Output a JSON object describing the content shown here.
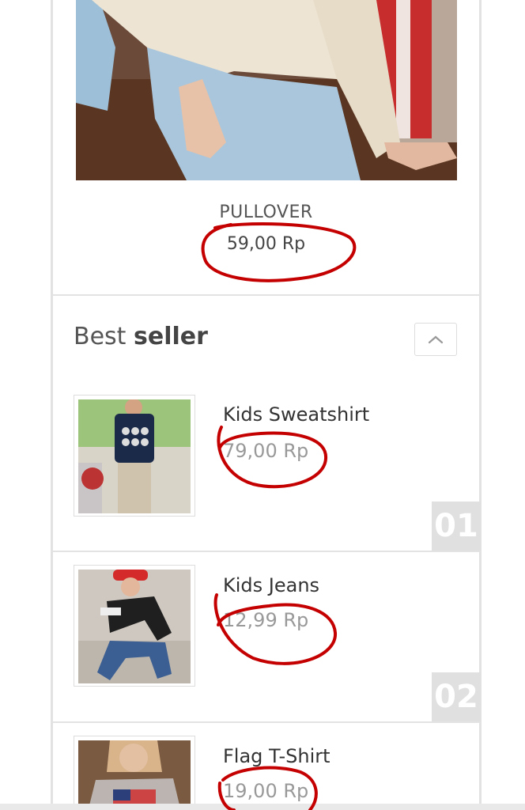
{
  "featured": {
    "name": "PULLOVER",
    "price": "59,00 Rp"
  },
  "best_seller": {
    "title_light": "Best",
    "title_bold": "seller",
    "collapse_icon": "chevron-up-icon",
    "items": [
      {
        "name": "Kids Sweatshirt",
        "price": "79,00 Rp",
        "rank": "01"
      },
      {
        "name": "Kids Jeans",
        "price": "12,99 Rp",
        "rank": "02"
      },
      {
        "name": "Flag T-Shirt",
        "price": "19,00 Rp"
      }
    ]
  },
  "colors": {
    "annotation_red": "#c40000",
    "rank_badge": "#e0e0e0"
  }
}
